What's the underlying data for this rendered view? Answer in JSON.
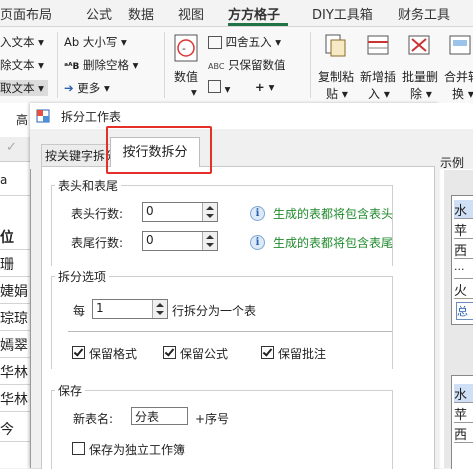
{
  "ribbon": {
    "tabs": [
      "页面布局",
      "公式",
      "数据",
      "视图",
      "方方格子",
      "DIY工具箱",
      "财务工具"
    ],
    "active_tab": "方方格子",
    "left_items": [
      "入文本 ▾",
      "除文本 ▾",
      "取文本 ▾"
    ],
    "case_label": "Ab 大小写 ▾",
    "delete_space_label": "删除空格 ▾",
    "more_label": "更多 ▾",
    "numeric_label": "数值",
    "rounding_label": "四舍五入 ▾",
    "keep_numeric_label": "只保留数值",
    "plus_label": "+ ▾",
    "copy_paste_label": [
      "复制粘",
      "贴 ▾"
    ],
    "insert_label": [
      "新增插",
      "入 ▾"
    ],
    "batch_delete_label": [
      "批量删",
      "除 ▾"
    ],
    "merge_label": [
      "合并转",
      "换 ▾"
    ],
    "group_label_left": "高"
  },
  "sheet_left": {
    "cells": [
      "位",
      "珊",
      "婕娟",
      "琮琼",
      "嫣翠",
      "华林",
      "华林",
      "今"
    ]
  },
  "dialog": {
    "title": "拆分工作表",
    "tabs": [
      "按关键字拆分",
      "按行数拆分"
    ],
    "active_tab": "按行数拆分",
    "header_footer": {
      "group_title": "表头和表尾",
      "header_rows_label": "表头行数:",
      "header_rows_value": "0",
      "header_hint": "生成的表都将包含表头",
      "footer_rows_label": "表尾行数:",
      "footer_rows_value": "0",
      "footer_hint": "生成的表都将包含表尾"
    },
    "split_options": {
      "group_title": "拆分选项",
      "per_label": "每",
      "rows_value": "1",
      "rows_suffix": "行拆分为一个表",
      "keep_format_label": "保留格式",
      "keep_format": true,
      "keep_formula_label": "保留公式",
      "keep_formula": true,
      "keep_comment_label": "保留批注",
      "keep_comment": true
    },
    "save": {
      "group_title": "保存",
      "new_name_label": "新表名:",
      "new_name_value": "分表",
      "suffix_label": "+序号",
      "independent_workbook_label": "保存为独立工作簿",
      "independent_workbook": false
    },
    "example": {
      "label": "示例",
      "table1": [
        "水",
        "苹",
        "西",
        "...",
        "火"
      ],
      "table1_tab": "总",
      "table2": [
        "水",
        "苹",
        "西"
      ]
    }
  },
  "colors": {
    "accent": "#217346",
    "highlight_box": "#e5302a",
    "hint_text": "#1f8a2b"
  }
}
